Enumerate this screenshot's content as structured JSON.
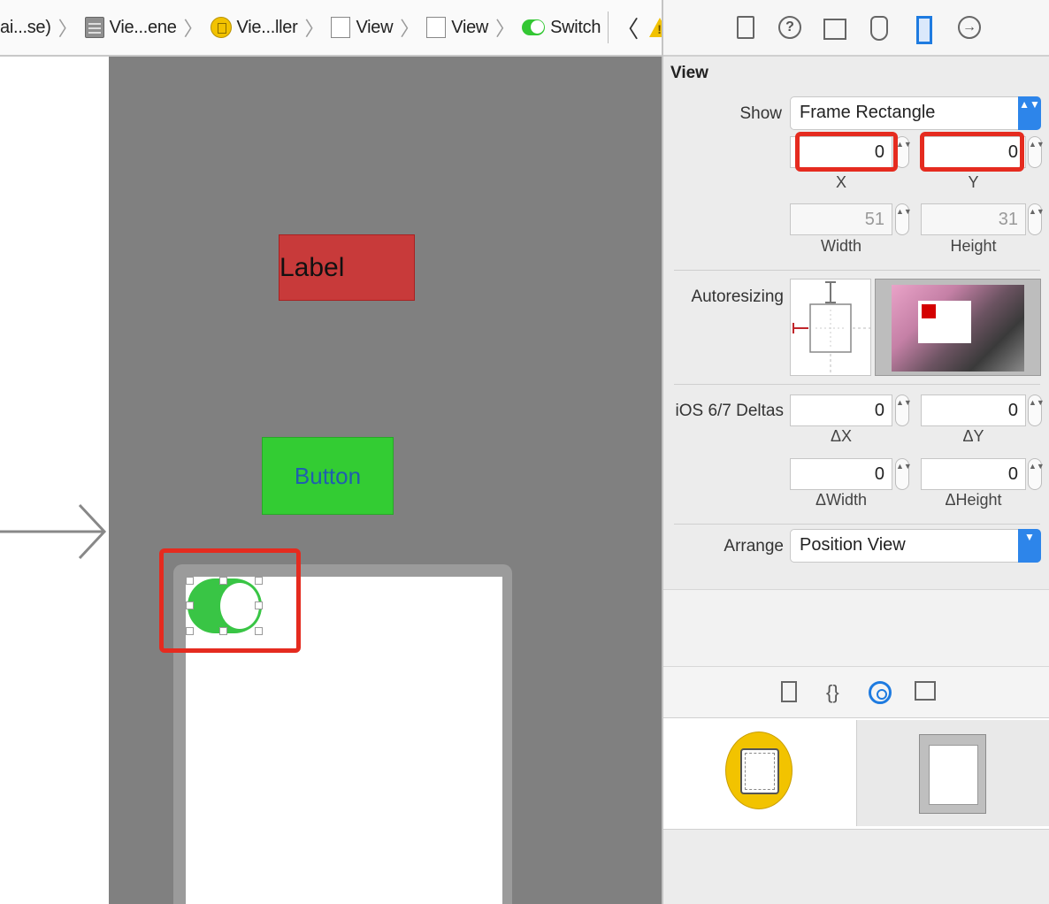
{
  "breadcrumb": {
    "items": [
      {
        "label": "ai...se)",
        "icon": "folder-icon"
      },
      {
        "label": "Vie...ene",
        "icon": "storyboard-scene-icon"
      },
      {
        "label": "Vie...ller",
        "icon": "view-controller-icon"
      },
      {
        "label": "View",
        "icon": "view-icon"
      },
      {
        "label": "View",
        "icon": "view-icon"
      },
      {
        "label": "Switch",
        "icon": "switch-icon"
      }
    ],
    "separator": "〉",
    "prev": "〈",
    "next": "〉"
  },
  "canvas": {
    "label_text": "Label",
    "button_text": "Button",
    "label_color": "#c83a3a",
    "button_color": "#33cc33",
    "switch_on": true
  },
  "inspector": {
    "section_title": "View",
    "show_label": "Show",
    "show_value": "Frame Rectangle",
    "x_value": "0",
    "y_value": "0",
    "x_label": "X",
    "y_label": "Y",
    "width_value": "51",
    "height_value": "31",
    "width_label": "Width",
    "height_label": "Height",
    "autoresizing_label": "Autoresizing",
    "deltas_label": "iOS 6/7 Deltas",
    "dx_value": "0",
    "dy_value": "0",
    "dx_label": "ΔX",
    "dy_label": "ΔY",
    "dwidth_value": "0",
    "dheight_value": "0",
    "dwidth_label": "ΔWidth",
    "dheight_label": "ΔHeight",
    "arrange_label": "Arrange",
    "arrange_value": "Position View",
    "help_glyph": "?",
    "conn_glyph": "→",
    "code_glyph": "{}"
  },
  "stepper_glyph": "▲▼",
  "highlight_color": "#e52b1f",
  "accent_color": "#1e7be0"
}
